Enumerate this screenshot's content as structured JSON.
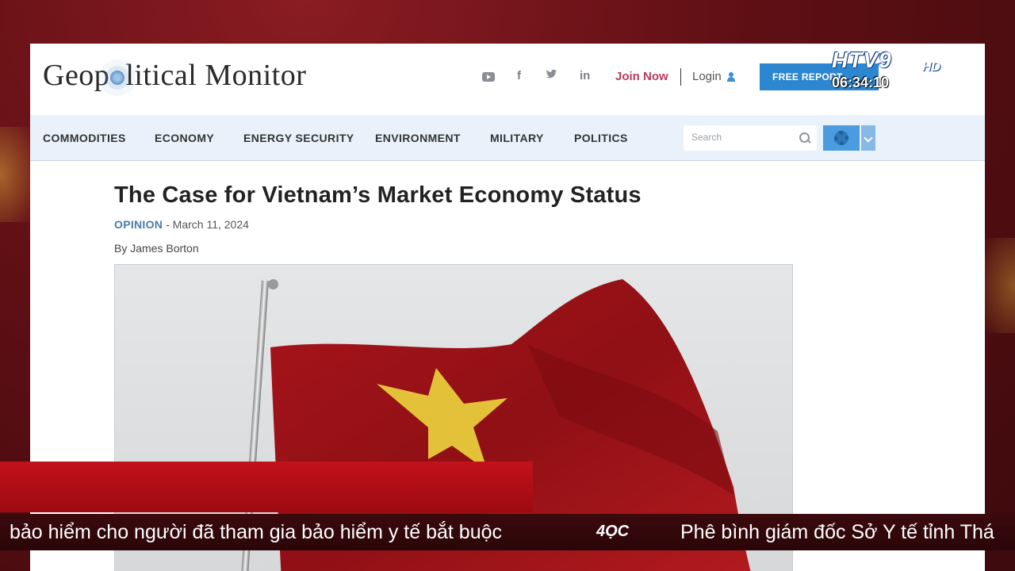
{
  "site": {
    "logo_text_before": "Geop",
    "logo_text_after": "litical Monitor",
    "join_label": "Join Now",
    "login_label": "Login",
    "free_report_label": "FREE REPORT"
  },
  "social_icons": [
    "youtube-icon",
    "facebook-icon",
    "twitter-icon",
    "linkedin-icon"
  ],
  "social_glyphs": {
    "facebook": "f",
    "twitter": "🐦",
    "linkedin": "in"
  },
  "nav": {
    "items": [
      {
        "label": "COMMODITIES"
      },
      {
        "label": "ECONOMY"
      },
      {
        "label": "ENERGY SECURITY"
      },
      {
        "label": "ENVIRONMENT"
      },
      {
        "label": "MILITARY"
      },
      {
        "label": "POLITICS"
      }
    ],
    "search_placeholder": "Search"
  },
  "article": {
    "title": "The Case for Vietnam’s Market Economy Status",
    "category": "OPINION",
    "date_sep": " - ",
    "date": "March 11, 2024",
    "byline": "By James Borton",
    "image": "vietnam-flag-photo"
  },
  "broadcast": {
    "channel": "HTV9",
    "hd": "HD",
    "time": "06:34:10",
    "ticker_left": "bảo hiểm cho người đã tham gia bảo hiểm y tế bắt buộc",
    "ticker_logo": "4ỌC",
    "ticker_right": "Phê bình giám đốc Sở Y tế tỉnh Thá"
  },
  "colors": {
    "accent": "#2c86d0",
    "join": "#c0395a",
    "nav_bg": "#e9f2fb",
    "flag_red": "#b0161c",
    "flag_star": "#e3c23a",
    "banner_red": "#c3121c"
  }
}
